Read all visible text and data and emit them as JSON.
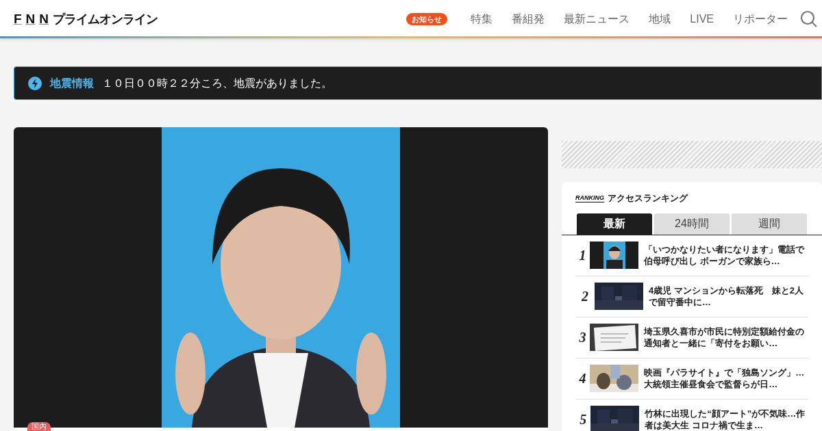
{
  "header": {
    "logo_letters": [
      "F",
      "N",
      "N"
    ],
    "logo_text": "プライムオンライン",
    "notice_badge": "お知らせ",
    "nav": [
      "特集",
      "番組発",
      "最新ニュース",
      "地域",
      "LIVE",
      "リポーター"
    ]
  },
  "alert": {
    "label": "地震情報",
    "message": "１０日００時２２分ころ、地震がありました。"
  },
  "hero": {
    "category": "国内"
  },
  "ranking": {
    "logo": "RANKING",
    "title": "アクセスランキング",
    "tabs": [
      {
        "label": "最新",
        "selected": true
      },
      {
        "label": "24時間",
        "selected": false
      },
      {
        "label": "週間",
        "selected": false
      }
    ],
    "items": [
      {
        "rank": "1",
        "title": "「いつかなりたい者になります」電話で伯母呼び出し ボーガンで家族ら…"
      },
      {
        "rank": "2",
        "title": "4歳児 マンションから転落死　妹と2人で留守番中に…"
      },
      {
        "rank": "3",
        "title": "埼玉県久喜市が市民に特別定額給付金の通知者と一緒に「寄付をお願い…",
        "kind": "picture"
      },
      {
        "rank": "4",
        "title": "映画『パラサイト』で「独島ソング」…大統領主催昼食会で監督らが日…"
      },
      {
        "rank": "5",
        "title": "竹林に出現した“顔アート”が不気味…作者は美大生 コロナ禍で生ま…"
      }
    ]
  }
}
